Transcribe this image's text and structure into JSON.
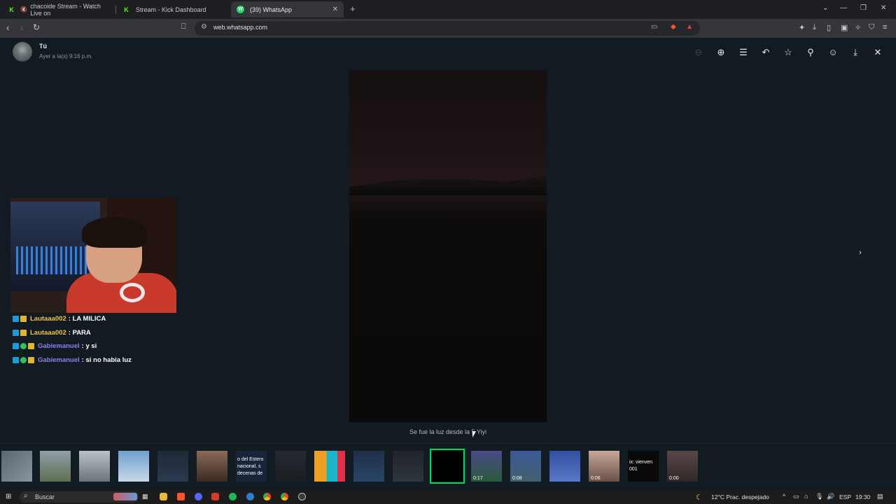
{
  "browser": {
    "tabs": [
      {
        "label": "chacoide Stream - Watch Live on",
        "favicon": "K",
        "favicon_color": "#53fc18"
      },
      {
        "label": "Stream - Kick Dashboard",
        "favicon": "K",
        "favicon_color": "#53fc18"
      },
      {
        "label": "(39) WhatsApp",
        "favicon": "W",
        "favicon_color": "#25d366"
      }
    ],
    "url": "web.whatsapp.com"
  },
  "viewer": {
    "sender": "Tú",
    "time": "Ayer a la(s) 9:16 p.m.",
    "caption": "Se fue la luz desde la 5 Yiyi"
  },
  "stream_chat": [
    {
      "user": "Lautaaa002",
      "message": ": LA MILICA",
      "user_color": "#f2c24a"
    },
    {
      "user": "Lautaaa002",
      "message": ": PARA",
      "user_color": "#f2c24a"
    },
    {
      "user": "Gabiemanuel",
      "message": ": y si",
      "user_color": "#8e7ff5"
    },
    {
      "user": "Gabiemanuel",
      "message": ": si no habia luz",
      "user_color": "#8e7ff5"
    }
  ],
  "thumbnails": {
    "t7_text": "o del Estero nacional, s decenas de",
    "t17_text": "ix: vienven 001",
    "durations": [
      "0:17",
      "0:08",
      "0:06",
      "0:00"
    ]
  },
  "taskbar": {
    "search": "Buscar",
    "weather": "12°C  Prac. despejado",
    "lang": "ESP",
    "clock": "19:30"
  },
  "colors": {
    "background": "#111b21",
    "accent": "#00d95a"
  }
}
